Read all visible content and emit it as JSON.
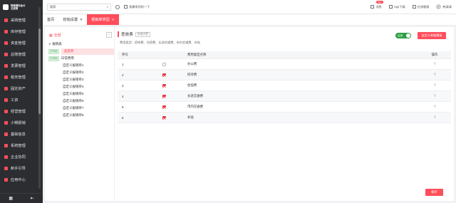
{
  "brand": {
    "name_line1": "畅捷通好会计",
    "name_line2": "云进销"
  },
  "sidebar": {
    "items": [
      {
        "label": "采购管理",
        "icon": "cart-icon"
      },
      {
        "label": "库存管理",
        "icon": "box-icon"
      },
      {
        "label": "资金管理",
        "icon": "money-icon"
      },
      {
        "label": "总账管理",
        "icon": "ledger-icon"
      },
      {
        "label": "发票管理",
        "icon": "invoice-icon"
      },
      {
        "label": "税务管理",
        "icon": "tax-icon"
      },
      {
        "label": "固定资产",
        "icon": "asset-icon"
      },
      {
        "label": "工资",
        "icon": "salary-icon"
      },
      {
        "label": "经营管理",
        "icon": "chart-icon"
      },
      {
        "label": "小畅报销",
        "icon": "reimburse-icon"
      },
      {
        "label": "基础信息",
        "icon": "info-icon"
      },
      {
        "label": "系统管理",
        "icon": "gear-icon"
      },
      {
        "label": "企业协同",
        "icon": "team-icon"
      },
      {
        "label": "新手引导",
        "icon": "guide-icon"
      },
      {
        "label": "应用中心",
        "icon": "apps-icon"
      }
    ]
  },
  "topbar": {
    "search_value": "搜索",
    "bookmark_label": "我最常用的一下",
    "notice_label": "消息",
    "notice_badge": "99+",
    "app_label": "App下载",
    "service_label": "在线客服",
    "user_name": "韩清清"
  },
  "tabs": [
    {
      "label": "首页"
    },
    {
      "label": "初始设置"
    },
    {
      "label": "报销单类型"
    }
  ],
  "left": {
    "header": "全部",
    "tree": [
      {
        "tag": "",
        "label": "报销类",
        "indent": 1
      },
      {
        "tag": "已开启",
        "label": "差旅费",
        "indent": 2,
        "selected": true
      },
      {
        "tag": "已开启",
        "label": "日常费用",
        "indent": 2
      },
      {
        "tag": "",
        "label": "自定义报销单1",
        "indent": 3
      },
      {
        "tag": "",
        "label": "自定义报销单2",
        "indent": 3
      },
      {
        "tag": "",
        "label": "自定义报销单3",
        "indent": 3
      },
      {
        "tag": "",
        "label": "自定义报销单4",
        "indent": 3
      },
      {
        "tag": "",
        "label": "自定义报销单5",
        "indent": 3
      },
      {
        "tag": "",
        "label": "自定义报销单6",
        "indent": 3
      },
      {
        "tag": "",
        "label": "自定义报销单7",
        "indent": 3
      },
      {
        "tag": "",
        "label": "自定义报销单8",
        "indent": 3
      }
    ]
  },
  "right": {
    "title": "差旅费",
    "sys_tag": "系统内置",
    "types_line": "费用类型：招待费、住宿费、长途交通费、市内交通费、补贴",
    "toggle_label": "启用",
    "custom_button": "自定义单据模板",
    "columns": {
      "no": "序号",
      "name": "费用类型名称",
      "op": "操作"
    },
    "rows": [
      {
        "no": "1",
        "checked": false,
        "name": "办公费"
      },
      {
        "no": "2",
        "checked": true,
        "name": "招待费"
      },
      {
        "no": "3",
        "checked": true,
        "name": "住宿费"
      },
      {
        "no": "4",
        "checked": true,
        "name": "长途交通费"
      },
      {
        "no": "5",
        "checked": true,
        "name": "市内交通费"
      },
      {
        "no": "6",
        "checked": true,
        "name": "补贴"
      }
    ],
    "save_button": "保存"
  },
  "colors": {
    "accent": "#ff4d5a",
    "sidebar_bg": "#2b2d31",
    "toggle_on": "#2ea043"
  }
}
